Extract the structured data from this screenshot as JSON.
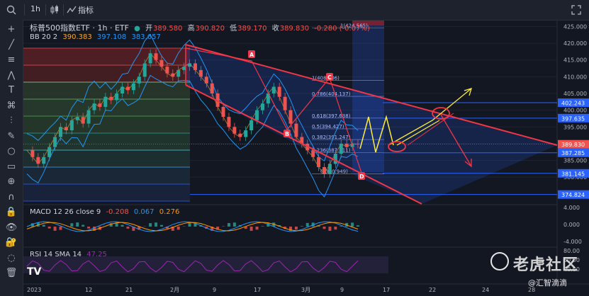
{
  "topbar": {
    "interval": "1h",
    "indicators_label": "指标",
    "symbol": "标普500指数ETF · 1h · ETF",
    "ohlc": {
      "open_label": "开",
      "open": "389.580",
      "high_label": "高",
      "high": "390.820",
      "low_label": "低",
      "low": "389.170",
      "close_label": "收",
      "close": "389.830",
      "change": "-0.280 (-0.07%)"
    }
  },
  "tools": [
    "crosshair-icon",
    "trend-line-icon",
    "horizontal-lines-icon",
    "multi-line-icon",
    "text-icon",
    "pattern-icon",
    "fib-icon",
    "brush-icon",
    "circle-icon",
    "ruler-icon",
    "zoom-in-icon",
    "magnet-icon",
    "lock-icon",
    "eye-icon",
    "lock-drawing-icon",
    "eye-hide-icon",
    "trash-icon"
  ],
  "bb_legend": {
    "label": "BB 20 2",
    "v1": "390.383",
    "v2": "397.108",
    "v3": "383.657",
    "c1": "#f9a825",
    "c2": "#2196f3",
    "c3": "#2196f3"
  },
  "macd_legend": {
    "label": "MACD 12 26 close 9",
    "v1": "-0.208",
    "v2": "0.067",
    "v3": "0.276",
    "c1": "#ef5350",
    "c2": "#2196f3",
    "c3": "#ff9800"
  },
  "rsi_legend": {
    "label": "RSI 14 SMA 14",
    "v1": "47.25"
  },
  "watermark": "老虎社区",
  "attribution": "@汇智滴滴",
  "tv_logo": "TV",
  "colors": {
    "up": "#26a69a",
    "down": "#ef5350",
    "bb": "#2196f3",
    "red_line": "#f23645",
    "yellow": "#ffeb3b",
    "blue_level": "#2962ff"
  },
  "chart_data": {
    "type": "line",
    "price_axis": {
      "ticks": [
        "425.000",
        "420.000",
        "415.000",
        "410.000",
        "405.000",
        "400.000",
        "395.000",
        "390.000",
        "385.000",
        "380.000"
      ],
      "ylim": [
        372,
        427
      ]
    },
    "time_axis": {
      "ticks": [
        "2023",
        "12",
        "21",
        "2月",
        "9",
        "17",
        "3月",
        "9",
        "17",
        "22",
        "24",
        "28"
      ]
    },
    "price_labels": [
      {
        "value": "402.243",
        "color": "#2962ff"
      },
      {
        "value": "397.635",
        "color": "#2962ff"
      },
      {
        "value": "389.830",
        "color": "#ef5350"
      },
      {
        "value": "387.285",
        "color": "#2962ff"
      },
      {
        "value": "381.145",
        "color": "#2962ff"
      },
      {
        "value": "374.824",
        "color": "#2962ff"
      }
    ],
    "wave_labels": [
      "A",
      "B",
      "C",
      "D"
    ],
    "fib_levels": [
      {
        "label": "1(424.565)",
        "value": 424.565
      },
      {
        "label": "1(408.906)",
        "value": 408.906
      },
      {
        "label": "0.786(404.137)",
        "value": 404.137
      },
      {
        "label": "0.618(397.638)",
        "value": 397.638
      },
      {
        "label": "0.5(394.427)",
        "value": 394.427
      },
      {
        "label": "0.382(391.247)",
        "value": 391.247
      },
      {
        "label": "0.236(387.311)",
        "value": 387.311
      },
      {
        "label": "0(380.949)",
        "value": 380.949
      }
    ],
    "series": [
      {
        "name": "price",
        "values": [
          388,
          386,
          384,
          386,
          389,
          392,
          395,
          394,
          397,
          398,
          396,
          400,
          402,
          401,
          404,
          403,
          405,
          407,
          406,
          408,
          410,
          414,
          417,
          415,
          413,
          411,
          410,
          412,
          413,
          414,
          412,
          410,
          408,
          405,
          401,
          398,
          395,
          393,
          392,
          394,
          397,
          400,
          402,
          405,
          407,
          404,
          400,
          396,
          392,
          390,
          388,
          386,
          383,
          381,
          384,
          387,
          390,
          389,
          390,
          389.83
        ]
      }
    ],
    "macd": {
      "ticks": [
        "4.000",
        "0.000",
        "-4.000"
      ]
    },
    "rsi": {
      "ticks": [
        "80.00",
        "60.00",
        "40.00"
      ]
    }
  }
}
